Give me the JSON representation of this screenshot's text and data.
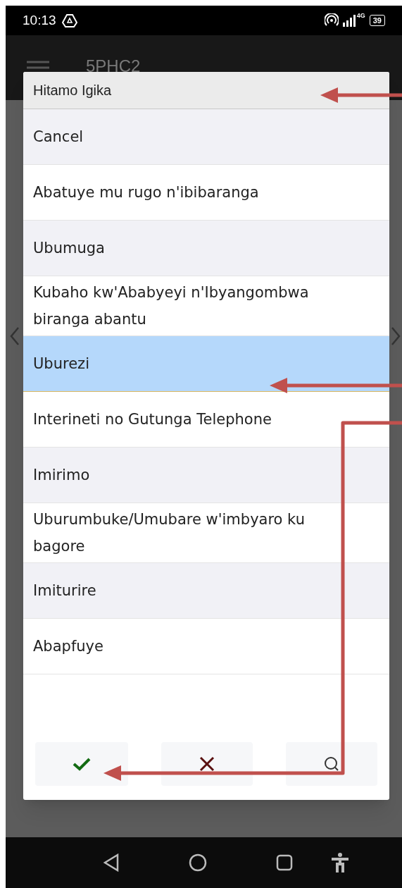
{
  "status_bar": {
    "time": "10:13",
    "network": "4G",
    "battery": "39"
  },
  "app_bar": {
    "title": "5PHC2"
  },
  "dialog": {
    "title": "Hitamo Igika",
    "options": [
      {
        "label": "Cancel",
        "selected": false
      },
      {
        "label": "Abatuye mu rugo n'ibibaranga",
        "selected": false
      },
      {
        "label": "Ubumuga",
        "selected": false
      },
      {
        "label": "Kubaho kw'Ababyeyi n'Ibyangombwa biranga abantu",
        "selected": false
      },
      {
        "label": "Uburezi",
        "selected": true
      },
      {
        "label": "Interineti no Gutunga Telephone",
        "selected": false
      },
      {
        "label": "Imirimo",
        "selected": false
      },
      {
        "label": "Uburumbuke/Umubare w'imbyaro ku bagore",
        "selected": false
      },
      {
        "label": "Imiturire",
        "selected": false
      },
      {
        "label": "Abapfuye",
        "selected": false
      }
    ]
  }
}
